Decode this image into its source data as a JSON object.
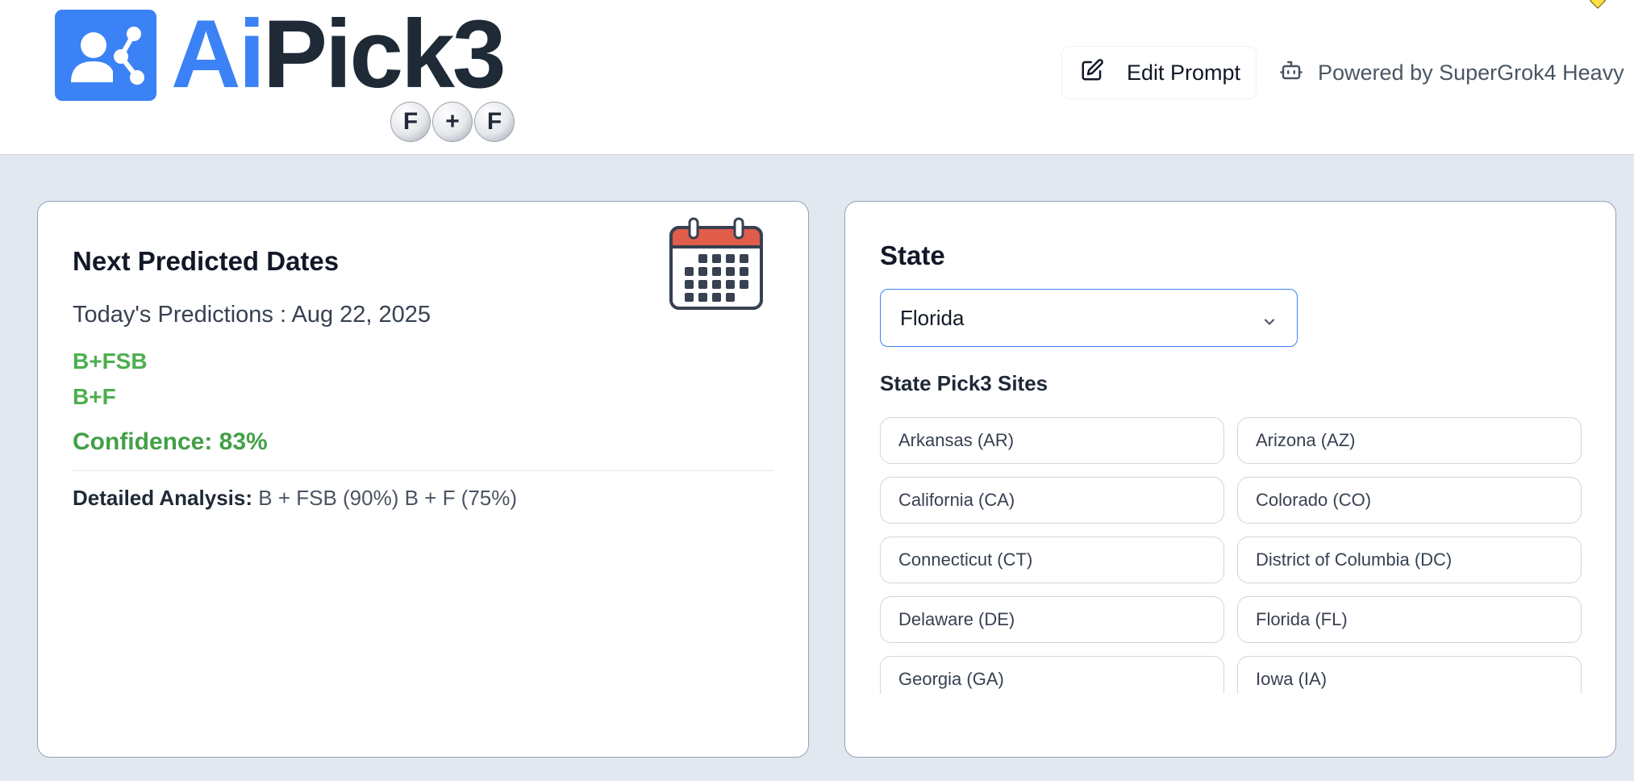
{
  "header": {
    "logo": {
      "part1": "Ai",
      "part2": "Pick3",
      "balls": [
        "F",
        "+",
        "F"
      ]
    },
    "edit_prompt_label": "Edit Prompt",
    "powered_by": "Powered by SuperGrok4 Heavy"
  },
  "predictions": {
    "title": "Next Predicted Dates",
    "today": "Today's Predictions : Aug 22, 2025",
    "items": [
      "B+FSB",
      "B+F"
    ],
    "confidence": "Confidence: 83%",
    "analysis_label": "Detailed Analysis:",
    "analysis_text": "B + FSB (90%) B + F (75%)"
  },
  "state": {
    "title": "State",
    "selected": "Florida",
    "sites_title": "State Pick3 Sites",
    "sites": [
      "Arkansas (AR)",
      "Arizona (AZ)",
      "California (CA)",
      "Colorado (CO)",
      "Connecticut (CT)",
      "District of Columbia (DC)",
      "Delaware (DE)",
      "Florida (FL)",
      "Georgia (GA)",
      "Iowa (IA)"
    ]
  },
  "colors": {
    "accent": "#3b82f6",
    "success": "#4caf50",
    "background": "#e2e8f0"
  },
  "icons": [
    "edit-icon",
    "robot-icon",
    "calendar-icon",
    "chevron-down-icon"
  ]
}
